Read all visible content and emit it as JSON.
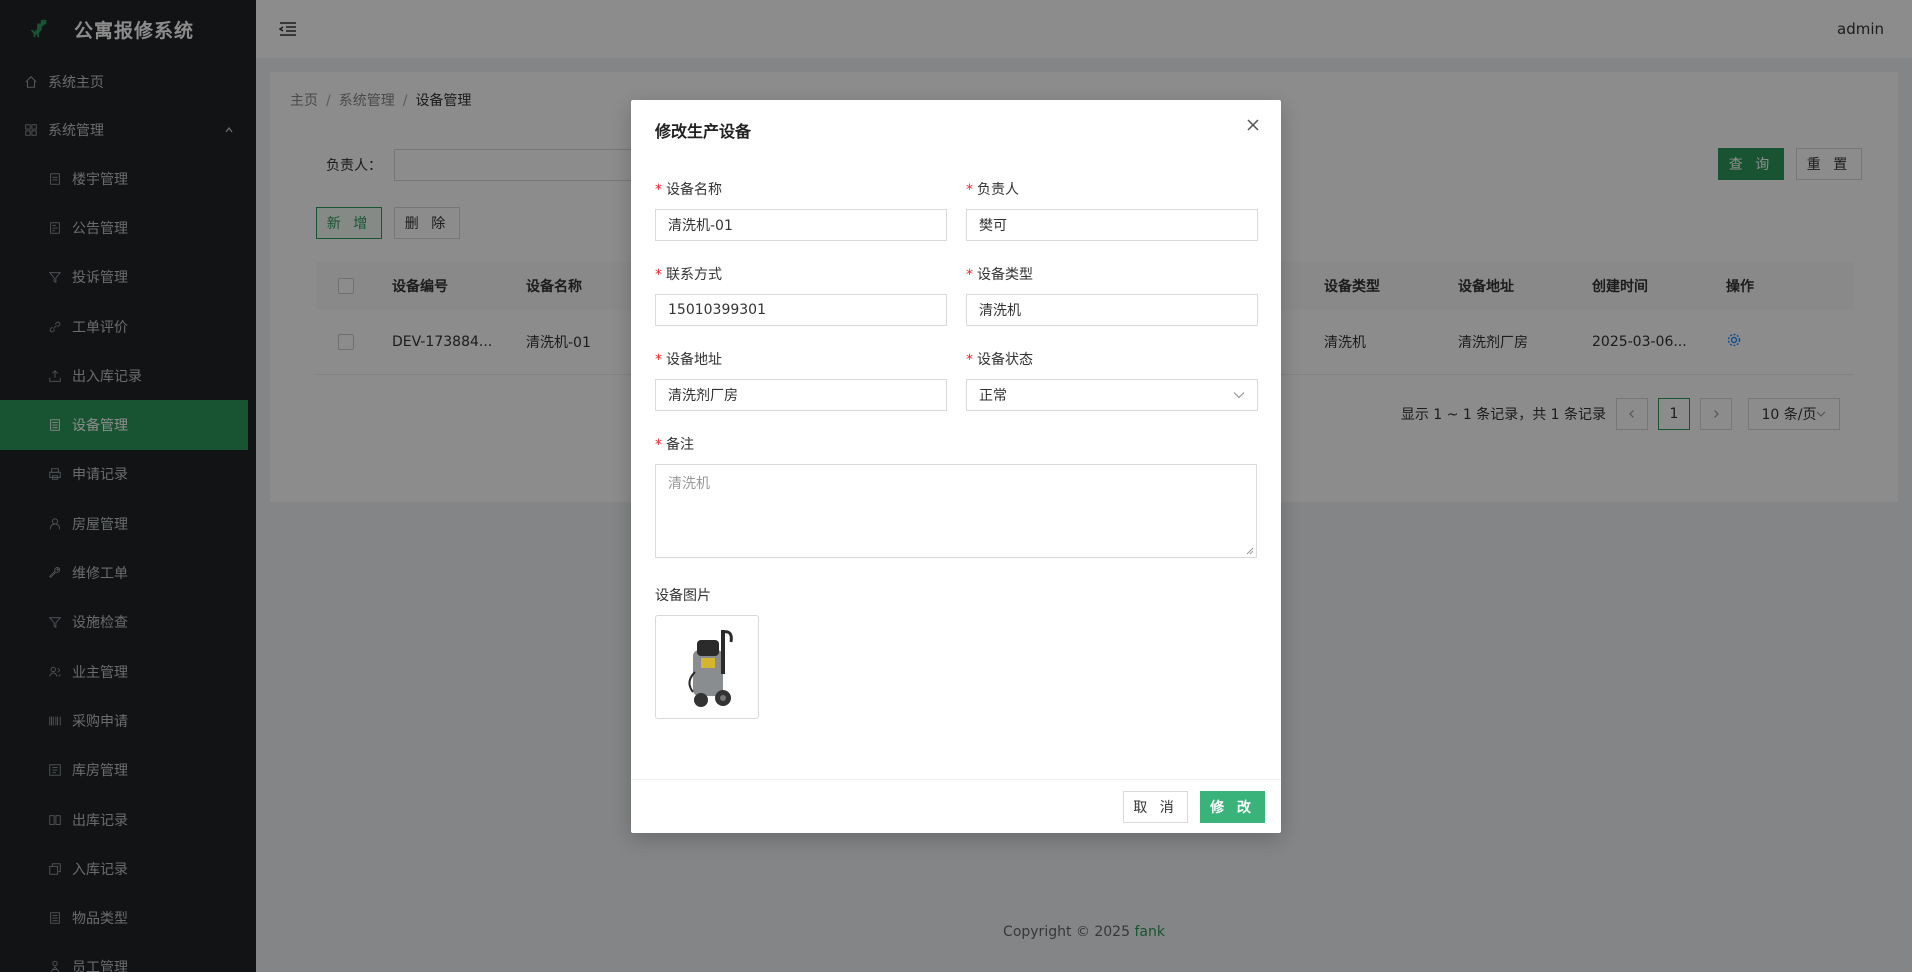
{
  "app": {
    "title": "公寓报修系统",
    "user": "admin"
  },
  "sidebar": {
    "home": "系统主页",
    "group": "系统管理",
    "items": [
      {
        "label": "楼宇管理",
        "icon": "document-icon"
      },
      {
        "label": "公告管理",
        "icon": "notice-icon"
      },
      {
        "label": "投诉管理",
        "icon": "filter-icon"
      },
      {
        "label": "工单评价",
        "icon": "link-icon"
      },
      {
        "label": "出入库记录",
        "icon": "upload-icon"
      },
      {
        "label": "设备管理",
        "icon": "list-icon",
        "active": true
      },
      {
        "label": "申请记录",
        "icon": "printer-icon"
      },
      {
        "label": "房屋管理",
        "icon": "user-icon"
      },
      {
        "label": "维修工单",
        "icon": "wrench-icon"
      },
      {
        "label": "设施检查",
        "icon": "filter-icon"
      },
      {
        "label": "业主管理",
        "icon": "team-icon"
      },
      {
        "label": "采购申请",
        "icon": "barcode-icon"
      },
      {
        "label": "库房管理",
        "icon": "warehouse-icon"
      },
      {
        "label": "出库记录",
        "icon": "book-icon"
      },
      {
        "label": "入库记录",
        "icon": "copy-icon"
      },
      {
        "label": "物品类型",
        "icon": "list-icon"
      },
      {
        "label": "员工管理",
        "icon": "staff-icon"
      }
    ]
  },
  "breadcrumb": [
    "主页",
    "系统管理",
    "设备管理"
  ],
  "search": {
    "label": "负责人：",
    "query": "查 询",
    "reset": "重 置"
  },
  "actions": {
    "add": "新 增",
    "delete": "删 除"
  },
  "table": {
    "headers": {
      "code": "设备编号",
      "name": "设备名称",
      "type": "设备类型",
      "addr": "设备地址",
      "created": "创建时间",
      "op": "操作"
    },
    "rows": [
      {
        "code": "DEV-173884...",
        "name": "清洗机-01",
        "type": "清洗机",
        "addr": "清洗剂厂房",
        "created": "2025-03-06..."
      }
    ]
  },
  "pagination": {
    "summary": "显示 1 ~ 1 条记录，共 1 条记录",
    "page": "1",
    "size": "10 条/页"
  },
  "copyright": {
    "text": "Copyright © 2025",
    "brand": "fank"
  },
  "modal": {
    "title": "修改生产设备",
    "fields": {
      "name": {
        "label": "设备名称",
        "value": "清洗机-01"
      },
      "owner": {
        "label": "负责人",
        "value": "樊可"
      },
      "phone": {
        "label": "联系方式",
        "value": "15010399301"
      },
      "type": {
        "label": "设备类型",
        "value": "清洗机"
      },
      "addr": {
        "label": "设备地址",
        "value": "清洗剂厂房"
      },
      "status": {
        "label": "设备状态",
        "value": "正常"
      },
      "remark": {
        "label": "备注",
        "placeholder": "清洗机"
      },
      "image": {
        "label": "设备图片"
      }
    },
    "cancel": "取 消",
    "submit": "修 改"
  }
}
